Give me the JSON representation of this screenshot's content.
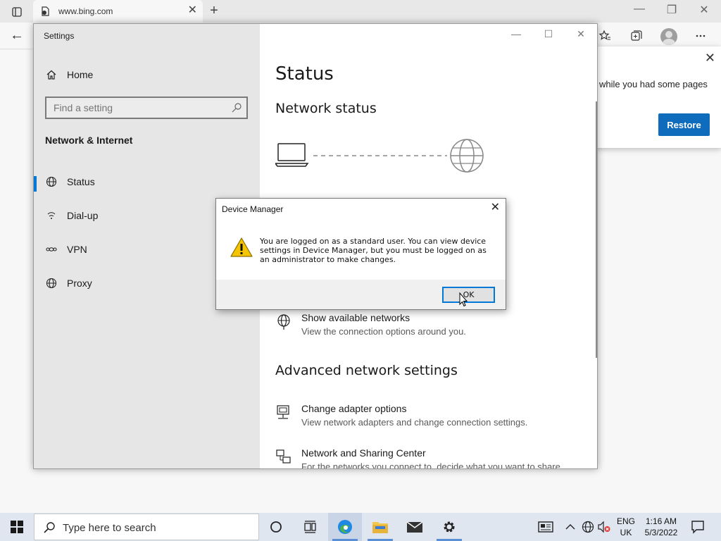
{
  "browser": {
    "tab_title": "www.bing.com",
    "tab_close": "✕",
    "new_tab": "+",
    "window_controls": {
      "minimize": "—",
      "restore": "❐",
      "close": "✕"
    },
    "back": "←",
    "restore_popup": {
      "text": "while you had some pages",
      "button": "Restore",
      "close": "✕"
    }
  },
  "settings": {
    "window_title": "Settings",
    "window_controls": {
      "minimize": "—",
      "maximize": "☐",
      "close": "✕"
    },
    "sidebar": {
      "home": "Home",
      "search_placeholder": "Find a setting",
      "section": "Network & Internet",
      "items": [
        {
          "label": "Status",
          "icon": "globe-icon",
          "active": true
        },
        {
          "label": "Dial-up",
          "icon": "dialup-icon",
          "active": false
        },
        {
          "label": "VPN",
          "icon": "vpn-icon",
          "active": false
        },
        {
          "label": "Proxy",
          "icon": "globe-icon",
          "active": false
        }
      ]
    },
    "main": {
      "title": "Status",
      "network_status": "Network status",
      "show_networks": {
        "title": "Show available networks",
        "desc": "View the connection options around you."
      },
      "advanced_heading": "Advanced network settings",
      "change_adapter": {
        "title": "Change adapter options",
        "desc": "View network adapters and change connection settings."
      },
      "sharing_center": {
        "title": "Network and Sharing Center",
        "desc": "For the networks you connect to, decide what you want to share."
      }
    }
  },
  "dialog": {
    "title": "Device Manager",
    "close": "✕",
    "message": "You are logged on as a standard user. You can view device settings in Device Manager, but you must be logged on as an administrator to make changes.",
    "ok": "OK"
  },
  "taskbar": {
    "search_placeholder": "Type here to search",
    "lang_top": "ENG",
    "lang_bottom": "UK",
    "time": "1:16 AM",
    "date": "5/3/2022",
    "accent": "#0078d7"
  }
}
